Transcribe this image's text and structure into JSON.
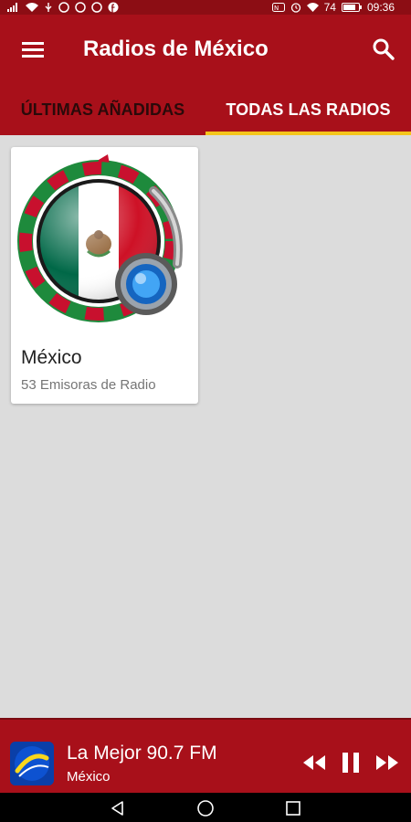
{
  "status_bar": {
    "battery_percent": "74",
    "time": "09:36",
    "icons": [
      "signal-icon",
      "wifi-icon",
      "usb-icon",
      "notification-icons",
      "nfc-icon",
      "alarm-icon",
      "battery-icon"
    ]
  },
  "app_bar": {
    "title": "Radios de México",
    "menu_icon": "hamburger-menu-icon",
    "search_icon": "search-icon"
  },
  "tabs": [
    {
      "label": "ÚLTIMAS AÑADIDAS",
      "active": false
    },
    {
      "label": "TODAS LAS RADIOS",
      "active": true
    }
  ],
  "countries": [
    {
      "name": "México",
      "subtitle": "53 Emisoras de Radio",
      "image": "mexico-flag-headphones"
    }
  ],
  "player": {
    "station_name": "La Mejor 90.7 FM",
    "station_country": "México",
    "logo": "la-mejor-logo",
    "controls": [
      "rewind-icon",
      "pause-icon",
      "fast-forward-icon"
    ]
  },
  "nav_bar": {
    "buttons": [
      "back-icon",
      "home-icon",
      "recents-icon"
    ]
  },
  "colors": {
    "primary": "#a8101a",
    "status_bar": "#8c0d14",
    "tab_indicator": "#f4c51c",
    "background": "#dcdcdc"
  }
}
